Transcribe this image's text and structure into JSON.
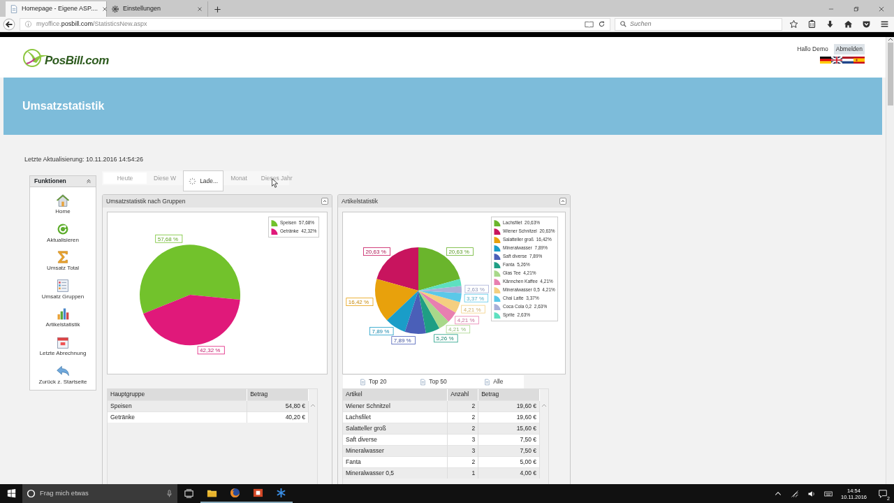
{
  "browser": {
    "tabs": [
      {
        "title": "Homepage - Eigene ASP....",
        "kind": "page",
        "selected": true
      },
      {
        "title": "Einstellungen",
        "kind": "settings",
        "selected": false
      }
    ],
    "url": {
      "subdomain": "myoffice.",
      "domain": "posbill.com",
      "path": "/StatisticsNew.aspx"
    },
    "search_placeholder": "Suchen"
  },
  "header": {
    "logo": "PosBill.com",
    "greeting": "Hallo Demo",
    "logout": "Abmelden",
    "flags": [
      {
        "kind": "de"
      },
      {
        "kind": "gb"
      },
      {
        "kind": "nl"
      },
      {
        "kind": "es"
      }
    ]
  },
  "banner": {
    "title": "Umsatzstatistik"
  },
  "last_update": "Letzte Aktualisierung: 10.11.2016 14:54:26",
  "sidebar": {
    "title": "Funktionen",
    "items": [
      {
        "label": "Home",
        "kind": "home"
      },
      {
        "label": "Aktualisieren",
        "kind": "refresh"
      },
      {
        "label": "Umsatz Total",
        "kind": "sum"
      },
      {
        "label": "Umsatz Gruppen",
        "kind": "list"
      },
      {
        "label": "Artikelstatistik",
        "kind": "bars"
      },
      {
        "label": "Letzte Abrechnung",
        "kind": "calendar"
      },
      {
        "label": "Zurück z. Startseite",
        "kind": "back"
      }
    ]
  },
  "periods": [
    {
      "label": "Heute",
      "selected": true
    },
    {
      "label": "Diese W",
      "selected": false
    },
    {
      "label": "Monat",
      "selected": false
    },
    {
      "label": "Dieses Jahr",
      "selected": false
    }
  ],
  "loading": "Lade...",
  "group_panel": {
    "title": "Umsatzstatistik nach Gruppen",
    "chart_data": {
      "type": "pie",
      "categories": [
        "Speisen",
        "Getränke"
      ],
      "series": [
        {
          "values": [
            57.68,
            42.32
          ]
        }
      ],
      "colors": [
        "#72c22c",
        "#e0197a"
      ],
      "value_labels": [
        "57,68 %",
        "42,32 %"
      ]
    },
    "legend": [
      {
        "share": "57,68%"
      },
      {
        "share": "42,32%"
      }
    ],
    "table": {
      "columns": [
        "Hauptgruppe",
        "Betrag"
      ],
      "rows": [
        [
          "Speisen",
          "54,80 €"
        ],
        [
          "Getränke",
          "40,20 €"
        ]
      ]
    }
  },
  "article_panel": {
    "title": "Artikelstatistik",
    "chart_data": {
      "type": "pie",
      "categories": [
        "Lachsfilet",
        "Wiener Schnitzel",
        "Salatteller groß",
        "Mineralwasser",
        "Saft diverse",
        "Fanta",
        "Glas Tee",
        "Kännchen Kaffee",
        "Mineralwasser 0,5",
        "Chai Latte",
        "Coca Cola 0,2",
        "Sprite"
      ],
      "series": [
        {
          "values": [
            20.63,
            20.63,
            16.42,
            7.89,
            7.89,
            5.26,
            4.21,
            4.21,
            4.21,
            3.37,
            2.63,
            2.63
          ]
        }
      ],
      "colors": [
        "#6ab52c",
        "#c8145e",
        "#e8a10c",
        "#1a9dc8",
        "#4a5fb8",
        "#1f9e84",
        "#a8d88a",
        "#e87fb0",
        "#f4cf80",
        "#5bc8e8",
        "#a8b0d8",
        "#5ee0c0"
      ],
      "value_labels": [
        "20,63 %",
        "20,63 %",
        "16,42 %",
        "7,89 %",
        "7,89 %",
        "5,26 %",
        "4,21 %",
        "4,21 %",
        "4,21 %",
        "3,37 %",
        "2,63 %",
        null
      ]
    },
    "legend": [
      {
        "share": "20,63%"
      },
      {
        "share": "20,63%"
      },
      {
        "share": "16,42%"
      },
      {
        "share": "7,89%"
      },
      {
        "share": "7,89%"
      },
      {
        "share": "5,26%"
      },
      {
        "share": "4,21%"
      },
      {
        "share": "4,21%"
      },
      {
        "share": "4,21%"
      },
      {
        "share": "3,37%"
      },
      {
        "share": "2,63%"
      },
      {
        "share": "2,63%"
      }
    ],
    "filters": [
      {
        "label": "Top 20"
      },
      {
        "label": "Top 50"
      },
      {
        "label": "Alle"
      }
    ],
    "table": {
      "columns": [
        "Artikel",
        "Anzahl",
        "Betrag"
      ],
      "rows": [
        [
          "Wiener Schnitzel",
          "2",
          "19,60 €"
        ],
        [
          "Lachsfilet",
          "2",
          "19,60 €"
        ],
        [
          "Salatteller groß",
          "2",
          "15,60 €"
        ],
        [
          "Saft diverse",
          "3",
          "7,50 €"
        ],
        [
          "Mineralwasser",
          "3",
          "7,50 €"
        ],
        [
          "Fanta",
          "2",
          "5,00 €"
        ],
        [
          "Mineralwasser 0,5",
          "1",
          "4,00 €"
        ]
      ]
    }
  },
  "taskbar": {
    "search_placeholder": "Frag mich etwas",
    "time": "14:54",
    "date": "10.11.2016",
    "notifications": "2"
  }
}
